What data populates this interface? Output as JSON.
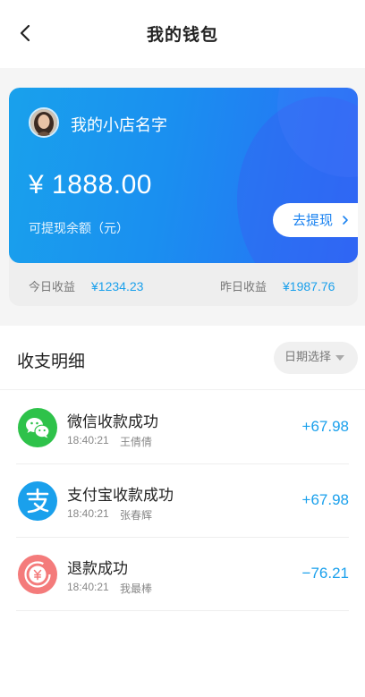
{
  "nav": {
    "title": "我的钱包"
  },
  "wallet": {
    "shop_name": "我的小店名字",
    "balance": "¥ 1888.00",
    "balance_label": "可提现余额（元）",
    "withdraw_label": "去提现",
    "today_label": "今日收益",
    "today_value": "¥1234.23",
    "yesterday_label": "昨日收益",
    "yesterday_value": "¥1987.76"
  },
  "details": {
    "title": "收支明细",
    "date_select_label": "日期选择"
  },
  "transactions": [
    {
      "title": "微信收款成功",
      "time": "18:40:21",
      "name": "王倩倩",
      "amount": "+67.98",
      "icon": "wechat-icon"
    },
    {
      "title": "支付宝收款成功",
      "time": "18:40:21",
      "name": "张春辉",
      "amount": "+67.98",
      "icon": "alipay-icon"
    },
    {
      "title": "退款成功",
      "time": "18:40:21",
      "name": "我最棒",
      "amount": "−76.21",
      "icon": "refund-icon"
    }
  ],
  "colors": {
    "accent": "#1aa0ec",
    "card_gradient_start": "#19a1ec",
    "card_gradient_end": "#2a6cf6",
    "wechat": "#2ec24a",
    "alipay": "#1aa0ec",
    "refund": "#f47b7b"
  }
}
